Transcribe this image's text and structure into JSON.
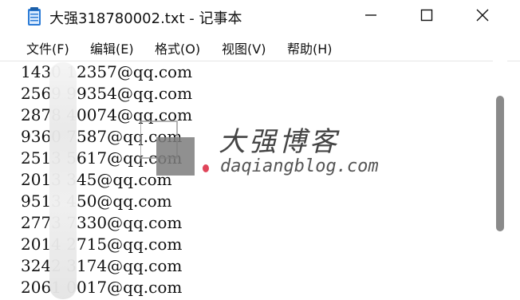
{
  "window": {
    "title": "大强318780002.txt - 记事本"
  },
  "menu": [
    {
      "label": "文件(F)"
    },
    {
      "label": "编辑(E)"
    },
    {
      "label": "格式(O)"
    },
    {
      "label": "视图(V)"
    },
    {
      "label": "帮助(H)"
    }
  ],
  "lines": [
    "1430   12357@qq.com",
    "2569   99354@qq.com",
    "2878   40074@qq.com",
    "9360   7587@qq.com",
    "2513   5617@qq.com",
    "2013   345@qq.com",
    "9513   450@qq.com",
    "2773   7330@qq.com",
    "2014   2715@qq.com",
    "3242   3174@qq.com",
    "2061   0017@qq.com"
  ],
  "watermark": {
    "title": "大强博客",
    "url": "daqiangblog.com"
  },
  "icons": {
    "app": "notepad-icon",
    "minimize": "minimize-icon",
    "maximize": "maximize-icon",
    "close": "close-icon"
  },
  "colors": {
    "text": "#111111",
    "scroll_thumb": "#8a8a8a",
    "watermark_dot": "#e0455a"
  }
}
